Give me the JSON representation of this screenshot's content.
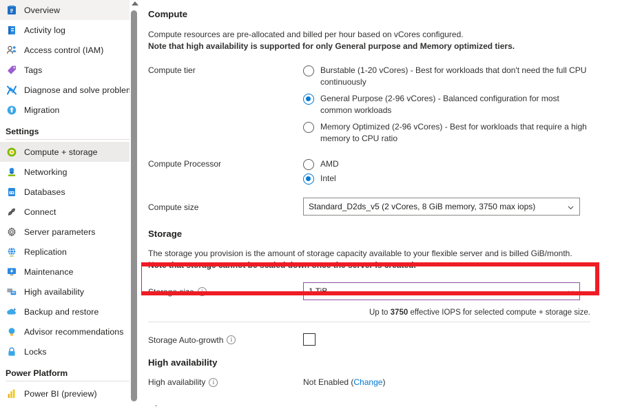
{
  "sidebar": {
    "items": [
      {
        "label": "Overview",
        "icon": "overview-icon",
        "selected": false
      },
      {
        "label": "Activity log",
        "icon": "activity-log-icon",
        "selected": false
      },
      {
        "label": "Access control (IAM)",
        "icon": "access-control-icon",
        "selected": false
      },
      {
        "label": "Tags",
        "icon": "tags-icon",
        "selected": false
      },
      {
        "label": "Diagnose and solve problems",
        "icon": "diagnose-icon",
        "selected": false
      },
      {
        "label": "Migration",
        "icon": "migration-icon",
        "selected": false
      }
    ],
    "section_settings": "Settings",
    "settings_items": [
      {
        "label": "Compute + storage",
        "icon": "compute-storage-icon",
        "selected": true
      },
      {
        "label": "Networking",
        "icon": "networking-icon",
        "selected": false
      },
      {
        "label": "Databases",
        "icon": "databases-icon",
        "selected": false
      },
      {
        "label": "Connect",
        "icon": "connect-icon",
        "selected": false
      },
      {
        "label": "Server parameters",
        "icon": "server-parameters-icon",
        "selected": false
      },
      {
        "label": "Replication",
        "icon": "replication-icon",
        "selected": false
      },
      {
        "label": "Maintenance",
        "icon": "maintenance-icon",
        "selected": false
      },
      {
        "label": "High availability",
        "icon": "high-availability-icon",
        "selected": false
      },
      {
        "label": "Backup and restore",
        "icon": "backup-restore-icon",
        "selected": false
      },
      {
        "label": "Advisor recommendations",
        "icon": "advisor-icon",
        "selected": false
      },
      {
        "label": "Locks",
        "icon": "locks-icon",
        "selected": false
      }
    ],
    "section_power_platform": "Power Platform",
    "power_platform_items": [
      {
        "label": "Power BI (preview)",
        "icon": "power-bi-icon",
        "selected": false
      }
    ]
  },
  "compute": {
    "heading": "Compute",
    "description_line1": "Compute resources are pre-allocated and billed per hour based on vCores configured.",
    "description_line2": "Note that high availability is supported for only General purpose and Memory optimized tiers.",
    "tier_label": "Compute tier",
    "tier_options": [
      {
        "label": "Burstable (1-20 vCores) - Best for workloads that don't need the full CPU continuously",
        "checked": false
      },
      {
        "label": "General Purpose (2-96 vCores) - Balanced configuration for most common workloads",
        "checked": true
      },
      {
        "label": "Memory Optimized (2-96 vCores) - Best for workloads that require a high memory to CPU ratio",
        "checked": false
      }
    ],
    "processor_label": "Compute Processor",
    "processor_options": [
      {
        "label": "AMD",
        "checked": false
      },
      {
        "label": "Intel",
        "checked": true
      }
    ],
    "size_label": "Compute size",
    "size_value": "Standard_D2ds_v5 (2 vCores, 8 GiB memory, 3750 max iops)"
  },
  "storage": {
    "heading": "Storage",
    "description_line1": "The storage you provision is the amount of storage capacity available to your flexible server and is billed GiB/month.",
    "description_line2": "Note that storage cannot be scaled down once the server is created.",
    "size_label": "Storage size",
    "size_value": "1 TiB",
    "iops_prefix": "Up to ",
    "iops_value": "3750",
    "iops_suffix": " effective IOPS for selected compute + storage size.",
    "autogrowth_label": "Storage Auto-growth",
    "autogrowth_checked": false
  },
  "high_availability": {
    "heading": "High availability",
    "label": "High availability",
    "value": "Not Enabled (",
    "change_link": "Change",
    "value_suffix": ")",
    "trailing_dot": "."
  },
  "colors": {
    "accent": "#0078d4",
    "annotation": "#ee1c25",
    "field_accent": "#8c4f9f",
    "selected_nav": "#edebe9"
  }
}
